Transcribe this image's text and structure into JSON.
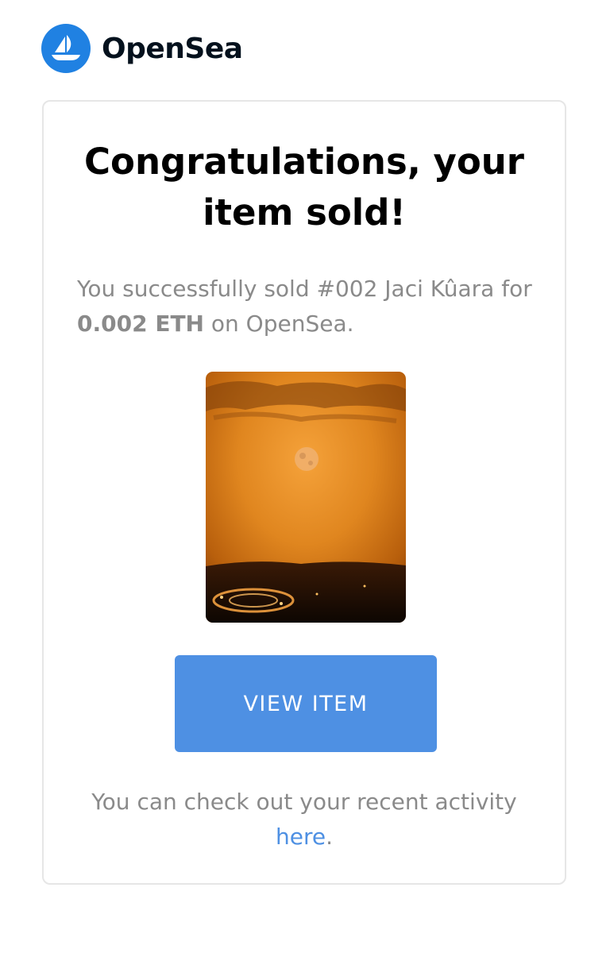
{
  "header": {
    "brand": "OpenSea",
    "logo_icon": "sailboat-icon",
    "logo_color": "#2081e2"
  },
  "card": {
    "title_line1": "Congratulations, your",
    "title_line2": "item sold!",
    "desc_prefix": "You successfully sold #002 Jaci Kûara for ",
    "desc_price": "0.002 ETH",
    "desc_suffix": " on OpenSea.",
    "image_icon": "nft-artwork-image",
    "button_label": "VIEW ITEM",
    "button_color": "#4e90e3",
    "footer_text": "You can check out your recent activity ",
    "footer_link": "here",
    "footer_period": "."
  }
}
